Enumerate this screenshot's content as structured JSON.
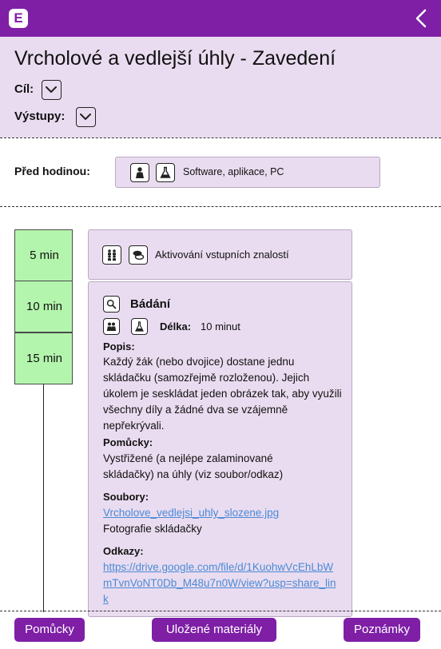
{
  "topbar": {
    "logo_letter": "E",
    "logo_icon": "app-logo",
    "back_icon": "chevron-left-icon",
    "color": "#7e1fa6"
  },
  "lesson": {
    "title": "Vrcholové a vedlejší úhly - Zavedení",
    "goal_label": "Cíl:",
    "outputs_label": "Výstupy:"
  },
  "before_class": {
    "label": "Před hodinou:",
    "icons": [
      "teacher-icon",
      "flask-icon"
    ],
    "text": "Software, aplikace, PC"
  },
  "timeline": {
    "items": [
      "5 min",
      "10 min",
      "15 min"
    ]
  },
  "activities": [
    {
      "icons": [
        "group-icon",
        "discussion-icon"
      ],
      "title": "Aktivování vstupních znalostí"
    },
    {
      "type_icon": "magnifier-icon",
      "title": "Bádání",
      "icons": [
        "pair-icon",
        "flask-icon"
      ],
      "length_label": "Délka:",
      "length_value": "10 minut",
      "description_label": "Popis:",
      "description": "Každý žák (nebo dvojice) dostane jednu skládačku (samozřejmě rozloženou). Jejich úkolem je seskládat jeden obrázek tak, aby využili všechny díly a žádné dva se vzájemně nepřekrývali.",
      "tools_label": "Pomůcky:",
      "tools": "Vystřižené (a nejlépe zalaminované skládačky) na úhly (viz soubor/odkaz)",
      "files_label": "Soubory:",
      "file_name": "Vrcholove_vedlejsi_uhly_slozene.jpg",
      "file_caption": "Fotografie skládačky",
      "links_label": "Odkazy:",
      "link_url": "https://drive.google.com/file/d/1KuohwVcEhLbWmTvnVoNT0Db_M48u7n0W/view?usp=share_link"
    }
  ],
  "bottom": {
    "tools_button": "Pomůcky",
    "saved_button": "Uložené materiály",
    "notes_button": "Poznámky"
  }
}
